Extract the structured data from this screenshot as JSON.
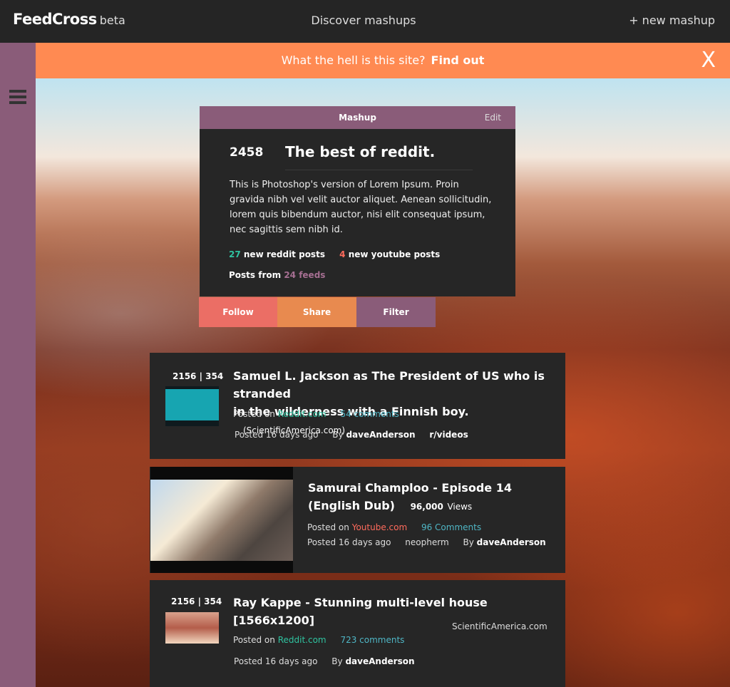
{
  "header": {
    "logo": "FeedCross",
    "logo_badge": "beta",
    "discover": "Discover mashups",
    "new_mashup": "+ new mashup"
  },
  "banner": {
    "text": "What the hell is this site?",
    "link": "Find out",
    "close": "X"
  },
  "mashup": {
    "header": "Mashup",
    "edit": "Edit",
    "count": "2458",
    "title": "The best of reddit.",
    "description": "This is Photoshop's version  of Lorem Ipsum. Proin gravida nibh vel velit auctor aliquet. Aenean sollicitudin, lorem quis bibendum auctor, nisi elit consequat ipsum, nec sagittis sem nibh id.",
    "reddit_new_count": "27",
    "reddit_new_label": "new reddit posts",
    "youtube_new_count": "4",
    "youtube_new_label": "new youtube posts",
    "posts_from_label": "Posts from",
    "feeds_count": "24 feeds"
  },
  "actions": {
    "follow": "Follow",
    "share": "Share",
    "filter": "Filter"
  },
  "posts": [
    {
      "score": "2156 | 354",
      "title_line1": "Samuel L. Jackson as The President of US who is stranded",
      "title_line2": "in the wilderness with a Finnish boy.",
      "source_domain": "(ScientificAmerica.com)",
      "posted_on_label": "Posted on",
      "site": "Reddit.com",
      "comments": "54 comments",
      "posted_ago": "Posted 16 days ago",
      "by_label": "By",
      "author": "daveAnderson",
      "subreddit": "r/videos"
    },
    {
      "title_line1": "Samurai Champloo - Episode 14",
      "title_line2": "(English Dub)",
      "views_count": "96,000",
      "views_label": "Views",
      "posted_on_label": "Posted on",
      "site": "Youtube.com",
      "comments": "96 Comments",
      "posted_ago": "Posted 16 days ago",
      "channel": "neopherm",
      "by_label": "By",
      "author": "daveAnderson"
    },
    {
      "score": "2156 | 354",
      "title": "Ray Kappe - Stunning multi-level house [1566x1200]",
      "source_domain": "ScientificAmerica.com",
      "posted_on_label": "Posted on",
      "site": "Reddit.com",
      "comments": "723 comments",
      "posted_ago": "Posted 16 days ago",
      "by_label": "By",
      "author": "daveAnderson"
    }
  ],
  "colors": {
    "topbar": "#252525",
    "sidebar": "#8a5c79",
    "banner": "#ff8a52",
    "reddit_green": "#2fc3a0",
    "youtube_red": "#ff6b5c",
    "comments_teal": "#4fb6c5",
    "follow": "#eb6e65",
    "share": "#e88a4f",
    "filter": "#8a5c79"
  },
  "icons": {
    "menu": "hamburger-icon"
  }
}
